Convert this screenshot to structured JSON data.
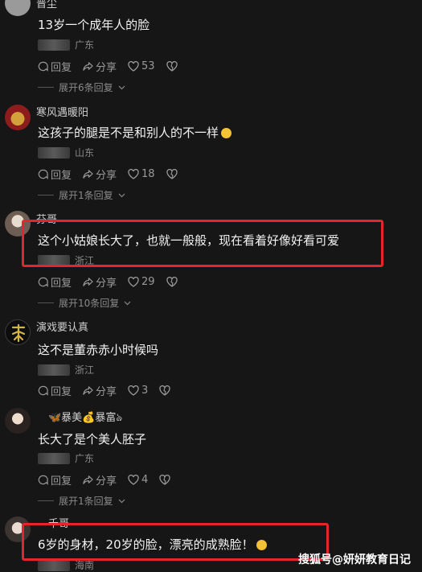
{
  "comments": [
    {
      "username": "晋尘",
      "text": "13岁一个成年人的脸",
      "location": "广东",
      "reply_label": "回复",
      "share_label": "分享",
      "likes": "53",
      "expand_label": "展开6条回复"
    },
    {
      "username": "寒风遇暖阳",
      "text": "这孩子的腿是不是和别人的不一样",
      "location": "山东",
      "reply_label": "回复",
      "share_label": "分享",
      "likes": "18",
      "expand_label": "展开1条回复"
    },
    {
      "username": "芬哥",
      "text": "这个小姑娘长大了，也就一般般，现在看着好像好看可爱",
      "location": "浙江",
      "reply_label": "回复",
      "share_label": "分享",
      "likes": "29",
      "expand_label": "展开10条回复"
    },
    {
      "username": "演戏要认真",
      "text": "这不是董赤赤小时候吗",
      "location": "浙江",
      "reply_label": "回复",
      "share_label": "分享",
      "likes": "3",
      "expand_label": ""
    },
    {
      "username": "🦋暴美💰暴富ঌ",
      "text": "长大了是个美人胚子",
      "location": "广东",
      "reply_label": "回复",
      "share_label": "分享",
      "likes": "4",
      "expand_label": "展开1条回复"
    },
    {
      "username": "千哥",
      "text": "6岁的身材，20岁的脸，漂亮的成熟脸！",
      "location": "海南",
      "reply_label": "",
      "share_label": "",
      "likes": "",
      "expand_label": ""
    }
  ],
  "watermark": "搜狐号@妍妍教育日记",
  "colors": {
    "highlight": "#e2262b",
    "background": "#161616"
  }
}
